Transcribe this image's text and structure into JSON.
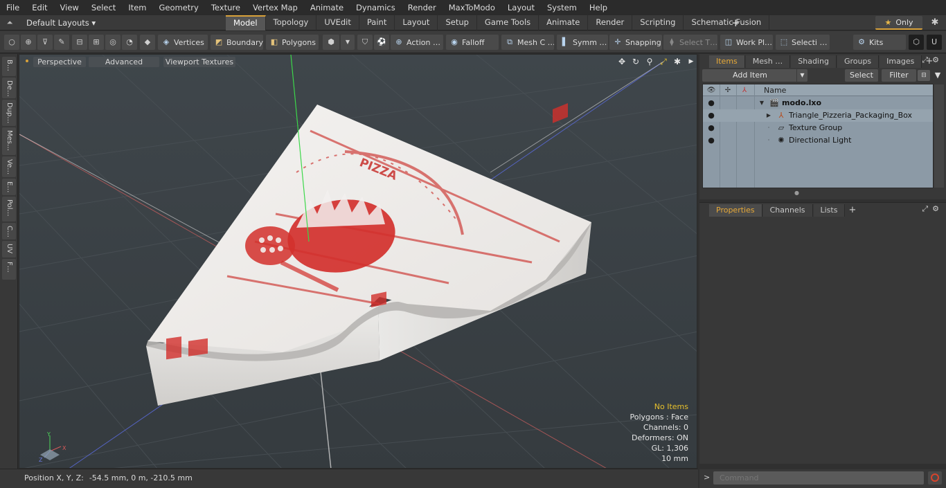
{
  "menu": [
    "File",
    "Edit",
    "View",
    "Select",
    "Item",
    "Geometry",
    "Texture",
    "Vertex Map",
    "Animate",
    "Dynamics",
    "Render",
    "MaxToModo",
    "Layout",
    "System",
    "Help"
  ],
  "layout": {
    "selector": "Default Layouts ▾",
    "tabs": [
      "Model",
      "Topology",
      "UVEdit",
      "Paint",
      "Layout",
      "Setup",
      "Game Tools",
      "Animate",
      "Render",
      "Scripting",
      "Schematic Fusion"
    ],
    "active_tab": "Model",
    "plus": "+",
    "only_label": "Only"
  },
  "toolbar": {
    "vertices": "Vertices",
    "boundary": "Boundary",
    "polygons": "Polygons",
    "action": "Action …",
    "falloff": "Falloff",
    "mesh": "Mesh C …",
    "symm": "Symm …",
    "snapping": "Snapping",
    "select_t": "Select T…",
    "work_pl": "Work Pl…",
    "selecti": "Selecti …",
    "kits": "Kits"
  },
  "left_tabs": [
    "B…",
    "De…",
    "Dup…",
    "Mes…",
    "Ve…",
    "E…",
    "Pol…",
    "C…",
    "UV",
    "F…"
  ],
  "viewport": {
    "perspective": "Perspective",
    "advanced": "Advanced",
    "viewport_textures": "Viewport Textures",
    "box_text": "PIZZA",
    "info": {
      "no_items": "No Items",
      "polygons": "Polygons : Face",
      "channels": "Channels: 0",
      "deformers": "Deformers: ON",
      "gl": "GL: 1,306",
      "scale": "10 mm"
    },
    "axis": {
      "x": "X",
      "y": "Y",
      "z": "Z"
    }
  },
  "status": {
    "position_label": "Position X, Y, Z:",
    "position_value": "-54.5 mm, 0 m, -210.5 mm"
  },
  "items_panel": {
    "tabs": [
      "Items",
      "Mesh …",
      "Shading",
      "Groups",
      "Images"
    ],
    "add_item": "Add Item",
    "select": "Select",
    "filter": "Filter",
    "name_header": "Name",
    "rows": [
      {
        "label": "modo.lxo",
        "indent": 0,
        "bold": true
      },
      {
        "label": "Triangle_Pizzeria_Packaging_Box",
        "indent": 1,
        "bold": false
      },
      {
        "label": "Texture Group",
        "indent": 1,
        "bold": false
      },
      {
        "label": "Directional Light",
        "indent": 1,
        "bold": false
      }
    ]
  },
  "properties_panel": {
    "tabs": [
      "Properties",
      "Channels",
      "Lists"
    ]
  },
  "command": {
    "placeholder": "Command"
  },
  "colors": {
    "accent": "#d9a23a",
    "pizza_red": "#c8302c",
    "grid_bg": "#3b4247"
  }
}
